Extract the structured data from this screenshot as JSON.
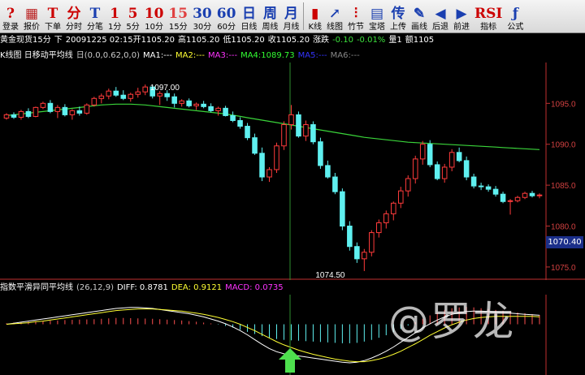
{
  "toolbar": {
    "items": [
      {
        "name": "login",
        "glyph": "?",
        "label": "登录",
        "color": "#c00"
      },
      {
        "name": "quote",
        "glyph": "▦",
        "label": "报价",
        "color": "#b22"
      },
      {
        "name": "order",
        "glyph": "T",
        "label": "下单",
        "color": "#c00"
      },
      {
        "name": "tick",
        "glyph": "分",
        "label": "分时",
        "color": "#c00"
      },
      {
        "name": "trade-detail",
        "glyph": "T",
        "label": "分笔",
        "color": "#1a3fb0"
      },
      {
        "name": "1min",
        "glyph": "1",
        "label": "1分",
        "color": "#c00"
      },
      {
        "name": "5min",
        "glyph": "5",
        "label": "5分",
        "color": "#c00"
      },
      {
        "name": "10min",
        "glyph": "10",
        "label": "10分",
        "color": "#c00"
      },
      {
        "name": "15min",
        "glyph": "15",
        "label": "15分",
        "color": "#e04040"
      },
      {
        "name": "30min",
        "glyph": "30",
        "label": "30分",
        "color": "#1a3fb0"
      },
      {
        "name": "60min",
        "glyph": "60",
        "label": "60分",
        "color": "#1a3fb0"
      },
      {
        "name": "daily",
        "glyph": "日",
        "label": "日线",
        "color": "#1a3fb0"
      },
      {
        "name": "weekly",
        "glyph": "周",
        "label": "周线",
        "color": "#1a3fb0"
      },
      {
        "name": "monthly",
        "glyph": "月",
        "label": "月线",
        "color": "#1a3fb0"
      },
      {
        "name": "kline",
        "glyph": "▮",
        "label": "K线",
        "color": "#c00"
      },
      {
        "name": "line-chart",
        "glyph": "↗",
        "label": "线图",
        "color": "#1a3fb0"
      },
      {
        "name": "bamboo",
        "glyph": "⫶",
        "label": "竹节",
        "color": "#c00"
      },
      {
        "name": "tower",
        "glyph": "▤",
        "label": "宝塔",
        "color": "#1a3fb0"
      },
      {
        "name": "upload",
        "glyph": "传",
        "label": "上传",
        "color": "#1a3fb0"
      },
      {
        "name": "draw-line",
        "glyph": "✎",
        "label": "画线",
        "color": "#1a3fb0"
      },
      {
        "name": "back",
        "glyph": "◀",
        "label": "后退",
        "color": "#1a3fb0"
      },
      {
        "name": "forward",
        "glyph": "▶",
        "label": "前进",
        "color": "#1a3fb0"
      },
      {
        "name": "indicator",
        "glyph": "RSI",
        "label": "指标",
        "color": "#c00"
      },
      {
        "name": "formula",
        "glyph": "ƒ",
        "label": "公式",
        "color": "#1a3fb0"
      }
    ]
  },
  "info": [
    {
      "t": "黄金现货15分",
      "c": "#fff"
    },
    {
      "t": "下",
      "c": "#fff"
    },
    {
      "t": "20091225 02:15开1105.20",
      "c": "#fff"
    },
    {
      "t": "高1105.20",
      "c": "#fff"
    },
    {
      "t": "低1105.20",
      "c": "#fff"
    },
    {
      "t": "收1105.20",
      "c": "#fff"
    },
    {
      "t": "涨跌",
      "c": "#fff"
    },
    {
      "t": "-0.10",
      "c": "#3ce03c"
    },
    {
      "t": "-0.01%",
      "c": "#3ce03c"
    },
    {
      "t": "量1",
      "c": "#fff"
    },
    {
      "t": "额1105",
      "c": "#fff"
    }
  ],
  "indicators": [
    {
      "t": "K线图 日移动平均线",
      "c": "#fff"
    },
    {
      "t": "日(0.0,0.62,0,0)",
      "c": "#ccc"
    },
    {
      "t": "MA1:---",
      "c": "#fff"
    },
    {
      "t": "MA2:---",
      "c": "#ffff33"
    },
    {
      "t": "MA3:---",
      "c": "#ff33ff"
    },
    {
      "t": "MA4:1089.73",
      "c": "#33ff33"
    },
    {
      "t": "MA5:---",
      "c": "#3333ff"
    },
    {
      "t": "MA6:---",
      "c": "#888"
    }
  ],
  "macd": [
    {
      "t": "指数平滑异同平均线",
      "c": "#fff"
    },
    {
      "t": "(26,12,9)",
      "c": "#ccc"
    },
    {
      "t": "DIFF: 0.8781",
      "c": "#fff"
    },
    {
      "t": "DEA: 0.9121",
      "c": "#ffff33"
    },
    {
      "t": "MACD: 0.0735",
      "c": "#ff33ff"
    }
  ],
  "price_tag": "1070.40",
  "watermark": "@罗龙",
  "chart_data": {
    "type": "candlestick",
    "ylim": [
      1074,
      1099
    ],
    "y_ticks": [
      1095.0,
      1090.0,
      1085.0,
      1080.0,
      1075.0
    ],
    "annotations": [
      {
        "label": "1097.00",
        "value": 1097.0
      },
      {
        "label": "1074.50",
        "value": 1074.5
      }
    ],
    "ohlc": [
      [
        1093.2,
        1093.8,
        1093.0,
        1093.6
      ],
      [
        1093.6,
        1093.9,
        1093.1,
        1093.3
      ],
      [
        1093.3,
        1094.2,
        1093.0,
        1094.0
      ],
      [
        1094.0,
        1094.4,
        1093.2,
        1093.4
      ],
      [
        1093.4,
        1094.6,
        1093.3,
        1094.5
      ],
      [
        1094.5,
        1095.2,
        1094.3,
        1095.0
      ],
      [
        1095.0,
        1095.4,
        1093.8,
        1094.0
      ],
      [
        1094.0,
        1094.8,
        1093.2,
        1094.5
      ],
      [
        1094.5,
        1094.9,
        1093.4,
        1093.6
      ],
      [
        1093.6,
        1094.3,
        1093.0,
        1094.1
      ],
      [
        1094.1,
        1094.6,
        1093.5,
        1093.8
      ],
      [
        1093.8,
        1095.0,
        1093.6,
        1094.8
      ],
      [
        1094.8,
        1095.8,
        1094.6,
        1095.6
      ],
      [
        1095.6,
        1096.2,
        1095.0,
        1095.9
      ],
      [
        1095.9,
        1096.8,
        1095.5,
        1096.5
      ],
      [
        1096.5,
        1097.0,
        1095.8,
        1096.0
      ],
      [
        1096.0,
        1096.6,
        1095.4,
        1095.6
      ],
      [
        1095.6,
        1096.3,
        1095.2,
        1096.1
      ],
      [
        1096.1,
        1096.9,
        1095.7,
        1096.4
      ],
      [
        1096.4,
        1097.3,
        1096.0,
        1097.0
      ],
      [
        1097.0,
        1097.2,
        1095.6,
        1095.9
      ],
      [
        1095.9,
        1096.5,
        1094.8,
        1096.2
      ],
      [
        1096.2,
        1096.6,
        1095.3,
        1095.8
      ],
      [
        1095.8,
        1096.2,
        1094.5,
        1095.0
      ],
      [
        1095.0,
        1095.5,
        1094.6,
        1095.3
      ],
      [
        1095.3,
        1095.6,
        1094.5,
        1094.7
      ],
      [
        1094.7,
        1095.1,
        1094.2,
        1094.9
      ],
      [
        1094.9,
        1095.3,
        1094.4,
        1094.6
      ],
      [
        1094.6,
        1095.0,
        1093.9,
        1094.1
      ],
      [
        1094.1,
        1094.6,
        1093.5,
        1094.4
      ],
      [
        1094.4,
        1094.7,
        1093.4,
        1093.5
      ],
      [
        1093.5,
        1094.0,
        1092.7,
        1092.9
      ],
      [
        1092.9,
        1093.3,
        1091.9,
        1092.2
      ],
      [
        1092.2,
        1092.6,
        1090.5,
        1090.8
      ],
      [
        1090.8,
        1091.3,
        1088.7,
        1088.9
      ],
      [
        1088.9,
        1089.6,
        1085.5,
        1086.0
      ],
      [
        1086.0,
        1087.2,
        1085.4,
        1086.9
      ],
      [
        1086.9,
        1090.2,
        1086.5,
        1089.8
      ],
      [
        1089.8,
        1092.8,
        1089.3,
        1092.4
      ],
      [
        1092.4,
        1094.8,
        1091.8,
        1093.6
      ],
      [
        1093.6,
        1094.0,
        1090.8,
        1091.0
      ],
      [
        1091.0,
        1092.9,
        1090.4,
        1092.4
      ],
      [
        1092.4,
        1092.8,
        1090.0,
        1090.3
      ],
      [
        1090.3,
        1090.8,
        1087.0,
        1087.4
      ],
      [
        1087.4,
        1088.0,
        1085.8,
        1086.0
      ],
      [
        1086.0,
        1086.5,
        1083.9,
        1084.2
      ],
      [
        1084.2,
        1084.6,
        1079.5,
        1080.0
      ],
      [
        1080.0,
        1080.6,
        1077.0,
        1077.5
      ],
      [
        1077.5,
        1078.0,
        1075.5,
        1076.0
      ],
      [
        1076.0,
        1077.2,
        1074.5,
        1076.8
      ],
      [
        1076.8,
        1079.5,
        1076.3,
        1079.2
      ],
      [
        1079.2,
        1080.8,
        1078.6,
        1080.4
      ],
      [
        1080.4,
        1081.9,
        1079.7,
        1081.5
      ],
      [
        1081.5,
        1083.0,
        1080.7,
        1082.8
      ],
      [
        1082.8,
        1084.8,
        1082.2,
        1084.3
      ],
      [
        1084.3,
        1086.2,
        1083.6,
        1085.8
      ],
      [
        1085.8,
        1088.6,
        1085.2,
        1088.2
      ],
      [
        1088.2,
        1090.4,
        1087.5,
        1090.0
      ],
      [
        1090.0,
        1090.5,
        1087.2,
        1087.5
      ],
      [
        1087.5,
        1087.9,
        1085.6,
        1085.8
      ],
      [
        1085.8,
        1087.6,
        1085.3,
        1087.2
      ],
      [
        1087.2,
        1089.4,
        1086.7,
        1089.0
      ],
      [
        1089.0,
        1089.6,
        1087.8,
        1088.0
      ],
      [
        1088.0,
        1088.5,
        1085.6,
        1086.0
      ],
      [
        1086.0,
        1086.4,
        1084.6,
        1084.9
      ],
      [
        1084.9,
        1085.3,
        1084.4,
        1084.8
      ],
      [
        1084.8,
        1085.1,
        1084.2,
        1084.5
      ],
      [
        1084.5,
        1084.9,
        1083.6,
        1083.9
      ],
      [
        1083.9,
        1084.2,
        1082.8,
        1083.0
      ],
      [
        1083.0,
        1083.3,
        1081.4,
        1083.1
      ],
      [
        1083.1,
        1083.7,
        1082.9,
        1083.5
      ],
      [
        1083.5,
        1084.2,
        1083.3,
        1084.0
      ],
      [
        1084.0,
        1084.3,
        1083.5,
        1083.7
      ],
      [
        1083.7,
        1084.0,
        1083.4,
        1083.8
      ]
    ],
    "ma4": [
      1093.5,
      1093.6,
      1093.7,
      1093.8,
      1093.9,
      1094.0,
      1094.1,
      1094.2,
      1094.3,
      1094.4,
      1094.5,
      1094.6,
      1094.7,
      1094.8,
      1094.85,
      1094.9,
      1094.9,
      1094.9,
      1094.85,
      1094.8,
      1094.7,
      1094.6,
      1094.5,
      1094.4,
      1094.3,
      1094.2,
      1094.1,
      1094.0,
      1093.9,
      1093.8,
      1093.7,
      1093.55,
      1093.4,
      1093.25,
      1093.1,
      1092.95,
      1092.8,
      1092.65,
      1092.5,
      1092.35,
      1092.2,
      1092.05,
      1091.9,
      1091.75,
      1091.6,
      1091.45,
      1091.3,
      1091.15,
      1091.0,
      1090.85,
      1090.75,
      1090.65,
      1090.55,
      1090.45,
      1090.35,
      1090.25,
      1090.2,
      1090.15,
      1090.1,
      1090.05,
      1090.0,
      1089.95,
      1089.9,
      1089.85,
      1089.8,
      1089.75,
      1089.7,
      1089.65,
      1089.6,
      1089.55,
      1089.5,
      1089.45,
      1089.4,
      1089.35
    ],
    "macd_hist": [
      0.05,
      0.08,
      0.1,
      0.12,
      0.14,
      0.15,
      0.17,
      0.18,
      0.2,
      0.21,
      0.22,
      0.23,
      0.24,
      0.26,
      0.28,
      0.3,
      0.3,
      0.29,
      0.28,
      0.27,
      0.26,
      0.24,
      0.22,
      0.2,
      0.18,
      0.15,
      0.12,
      0.08,
      0.04,
      -0.02,
      -0.08,
      -0.16,
      -0.26,
      -0.36,
      -0.46,
      -0.56,
      -0.64,
      -0.7,
      -0.74,
      -0.76,
      -0.78,
      -0.8,
      -0.82,
      -0.84,
      -0.86,
      -0.88,
      -0.9,
      -0.9,
      -0.88,
      -0.82,
      -0.74,
      -0.64,
      -0.52,
      -0.38,
      -0.22,
      -0.06,
      0.1,
      0.26,
      0.42,
      0.56,
      0.68,
      0.76,
      0.8,
      0.82,
      0.8,
      0.76,
      0.72,
      0.68,
      0.64,
      0.6,
      0.56,
      0.52,
      0.48,
      0.44
    ],
    "diff": [
      0.0,
      0.2,
      0.4,
      0.6,
      0.8,
      1.0,
      1.2,
      1.4,
      1.6,
      1.8,
      2.0,
      2.2,
      2.4,
      2.6,
      2.8,
      3.0,
      3.1,
      3.2,
      3.2,
      3.1,
      3.0,
      2.8,
      2.6,
      2.4,
      2.2,
      2.0,
      1.7,
      1.4,
      1.0,
      0.6,
      0.1,
      -0.5,
      -1.2,
      -2.0,
      -2.9,
      -3.8,
      -4.6,
      -5.2,
      -5.6,
      -5.8,
      -6.0,
      -6.2,
      -6.4,
      -6.6,
      -6.8,
      -7.0,
      -7.2,
      -7.3,
      -7.2,
      -6.9,
      -6.4,
      -5.8,
      -5.1,
      -4.3,
      -3.4,
      -2.5,
      -1.6,
      -0.7,
      0.1,
      0.8,
      1.4,
      1.9,
      2.2,
      2.4,
      2.5,
      2.5,
      2.4,
      2.3,
      2.2,
      2.1,
      2.0,
      1.9,
      1.8,
      1.7
    ],
    "dea": [
      0.0,
      0.1,
      0.2,
      0.3,
      0.5,
      0.6,
      0.8,
      1.0,
      1.2,
      1.4,
      1.6,
      1.8,
      2.0,
      2.2,
      2.4,
      2.6,
      2.7,
      2.8,
      2.9,
      2.9,
      2.9,
      2.8,
      2.7,
      2.6,
      2.5,
      2.3,
      2.1,
      1.9,
      1.6,
      1.3,
      0.9,
      0.5,
      0.0,
      -0.6,
      -1.2,
      -1.9,
      -2.6,
      -3.3,
      -3.9,
      -4.4,
      -4.9,
      -5.3,
      -5.7,
      -6.0,
      -6.3,
      -6.6,
      -6.8,
      -7.0,
      -7.1,
      -7.1,
      -6.9,
      -6.6,
      -6.2,
      -5.7,
      -5.1,
      -4.4,
      -3.7,
      -2.9,
      -2.1,
      -1.4,
      -0.7,
      -0.1,
      0.4,
      0.8,
      1.1,
      1.3,
      1.4,
      1.5,
      1.5,
      1.5,
      1.5,
      1.5,
      1.5,
      1.4
    ],
    "macd_ylim": [
      -9,
      5
    ]
  }
}
